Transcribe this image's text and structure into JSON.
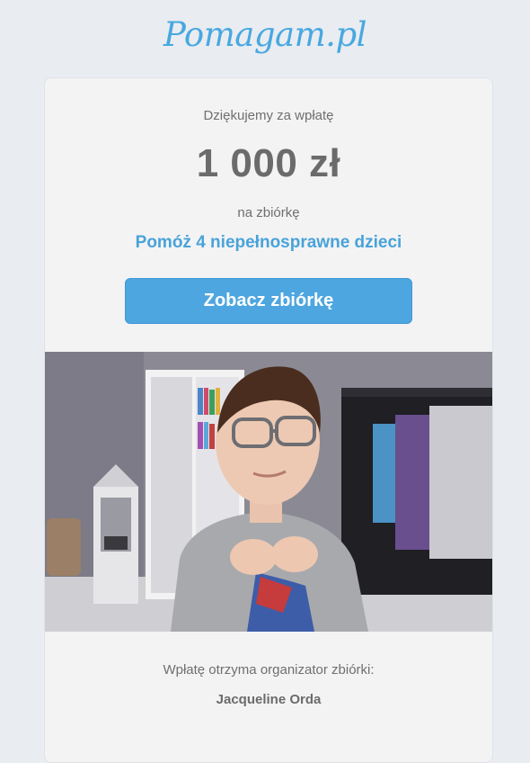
{
  "header": {
    "logo_text": "Pomagam.pl"
  },
  "card": {
    "thanks_text": "Dziękujemy za wpłatę",
    "amount": "1 000 zł",
    "to_text": "na zbiórkę",
    "fundraiser_title": "Pomóż 4 niepełnosprawne dzieci",
    "button_label": "Zobacz zbiórkę",
    "photo_alt": "photo of a child",
    "recipient_label": "Wpłatę otrzyma organizator zbiórki:",
    "recipient_name": "Jacqueline Orda"
  },
  "colors": {
    "brand": "#48a8e0",
    "button": "#4ea6e0",
    "page_bg": "#e9ecf1",
    "card_bg": "#f3f3f4",
    "text_gray": "#6f6f6f"
  }
}
